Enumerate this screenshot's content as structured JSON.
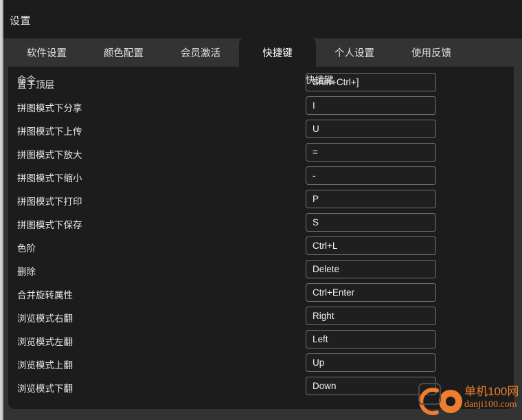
{
  "window": {
    "title": "设置"
  },
  "tabs": [
    {
      "label": "软件设置",
      "active": false
    },
    {
      "label": "颜色配置",
      "active": false
    },
    {
      "label": "会员激活",
      "active": false
    },
    {
      "label": "快捷键",
      "active": true
    },
    {
      "label": "个人设置",
      "active": false
    },
    {
      "label": "使用反馈",
      "active": false
    }
  ],
  "shortcuts_panel": {
    "headers": {
      "command": "命令",
      "shortcut": "快捷键"
    },
    "rows": [
      {
        "command": "置于顶层",
        "shortcut": "Shift+Ctrl+]"
      },
      {
        "command": "拼图模式下分享",
        "shortcut": "I"
      },
      {
        "command": "拼图模式下上传",
        "shortcut": "U"
      },
      {
        "command": "拼图模式下放大",
        "shortcut": "="
      },
      {
        "command": "拼图模式下缩小",
        "shortcut": "-"
      },
      {
        "command": "拼图模式下打印",
        "shortcut": "P"
      },
      {
        "command": "拼图模式下保存",
        "shortcut": "S"
      },
      {
        "command": "色阶",
        "shortcut": "Ctrl+L"
      },
      {
        "command": "删除",
        "shortcut": "Delete"
      },
      {
        "command": "合并旋转属性",
        "shortcut": "Ctrl+Enter"
      },
      {
        "command": "浏览模式右翻",
        "shortcut": "Right"
      },
      {
        "command": "浏览模式左翻",
        "shortcut": "Left"
      },
      {
        "command": "浏览模式上翻",
        "shortcut": "Up"
      },
      {
        "command": "浏览模式下翻",
        "shortcut": "Down"
      }
    ]
  },
  "watermark": {
    "site_cn": "单机100网",
    "site_en": "danji100.com",
    "color": "#ee7d2f"
  }
}
